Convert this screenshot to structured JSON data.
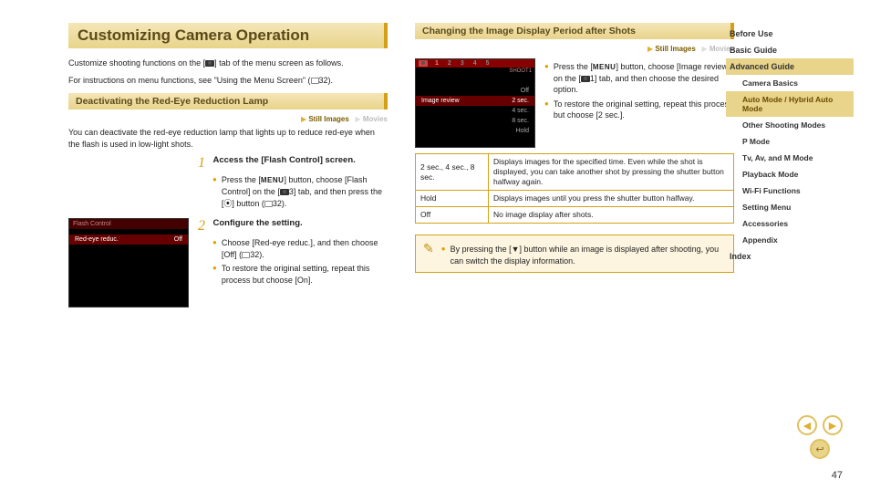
{
  "title": "Customizing Camera Operation",
  "intro1_a": "Customize shooting functions on the [",
  "intro1_b": "] tab of the menu screen as follows.",
  "intro2_a": "For instructions on menu functions, see \"Using the Menu Screen\" (",
  "intro2_b": "32).",
  "section1": "Deactivating the Red-Eye Reduction Lamp",
  "still": "Still Images",
  "movies": "Movies",
  "sec1_text": "You can deactivate the red-eye reduction lamp that lights up to reduce red-eye when the flash is used in low-light shots.",
  "lcd1": {
    "title": "Flash Control",
    "row_label": "Red-eye reduc.",
    "row_val": "Off"
  },
  "step1": {
    "num": "1",
    "title": "Access the [Flash Control] screen.",
    "b1a": "Press the [",
    "b1b": "] button, choose [Flash Control] on the [",
    "b1c": "3] tab, and then press the [",
    "b1d": "] button (",
    "b1e": "32)."
  },
  "step2": {
    "num": "2",
    "title": "Configure the setting.",
    "b1a": "Choose [Red-eye reduc.], and then choose [Off] (",
    "b1b": "32).",
    "b2": "To restore the original setting, repeat this process but choose [On]."
  },
  "section2": "Changing the Image Display Period after Shots",
  "lcd2": {
    "shoot": "SHOOT1",
    "row_label": "Image review",
    "opts": [
      "Off",
      "2 sec.",
      "4 sec.",
      "8 sec.",
      "Hold"
    ]
  },
  "sec2_b1a": "Press the [",
  "sec2_b1b": "] button, choose [Image review] on the [",
  "sec2_b1c": "1] tab, and then choose the desired option.",
  "sec2_b2": "To restore the original setting, repeat this process but choose [2 sec.].",
  "table": {
    "r1k": "2 sec., 4 sec., 8 sec.",
    "r1v": "Displays images for the specified time. Even while the shot is displayed, you can take another shot by pressing the shutter button halfway again.",
    "r2k": "Hold",
    "r2v": "Displays images until you press the shutter button halfway.",
    "r3k": "Off",
    "r3v": "No image display after shots."
  },
  "note_a": "By pressing the [",
  "note_b": "] button while an image is displayed after shooting, you can switch the display information.",
  "sidebar": {
    "before": "Before Use",
    "basic": "Basic Guide",
    "advanced": "Advanced Guide",
    "camera_basics": "Camera Basics",
    "auto": "Auto Mode / Hybrid Auto Mode",
    "other": "Other Shooting Modes",
    "pmode": "P Mode",
    "tvav": "Tv, Av, and M Mode",
    "playback": "Playback Mode",
    "wifi": "Wi-Fi Functions",
    "setting": "Setting Menu",
    "acc": "Accessories",
    "appendix": "Appendix",
    "index": "Index"
  },
  "page_number": "47"
}
